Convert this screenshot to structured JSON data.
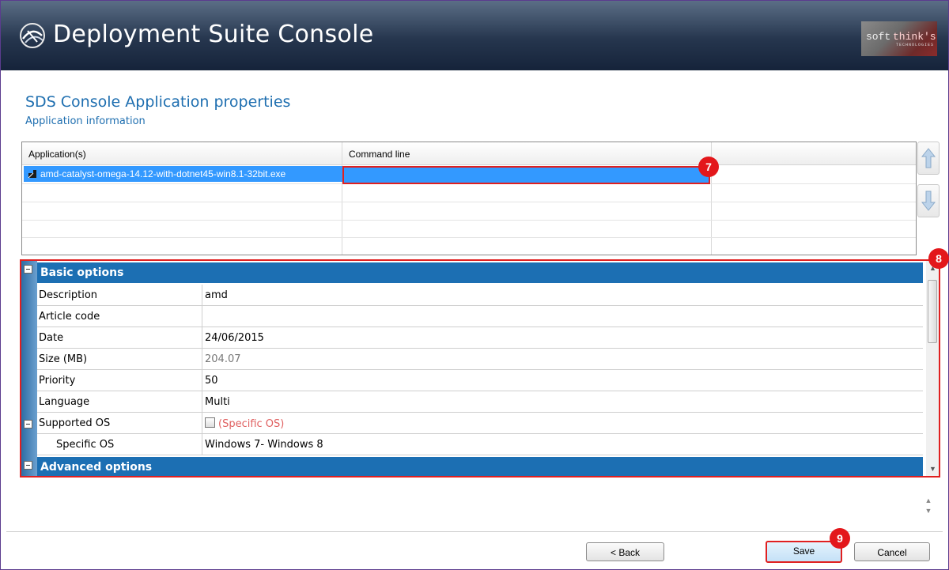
{
  "window": {
    "title": "Deployment Suite Console",
    "brand_left": "soft",
    "brand_right": "think's",
    "brand_tagline": "TECHNOLOGIES"
  },
  "page": {
    "title": "SDS Console Application properties",
    "subtitle": "Application information"
  },
  "app_grid": {
    "columns": [
      "Application(s)",
      "Command line"
    ],
    "rows": [
      {
        "application": "amd-catalyst-omega-14.12-with-dotnet45-win8.1-32bit.exe",
        "command_line": ""
      }
    ]
  },
  "properties": {
    "basic_header": "Basic options",
    "rows": [
      {
        "key": "Description",
        "value": "amd"
      },
      {
        "key": "Article code",
        "value": ""
      },
      {
        "key": "Date",
        "value": "24/06/2015"
      },
      {
        "key": "Size (MB)",
        "value": "204.07"
      },
      {
        "key": "Priority",
        "value": "50"
      },
      {
        "key": "Language",
        "value": "Multi"
      }
    ],
    "supported_os": {
      "key": "Supported OS",
      "value": "(Specific OS)",
      "checked": false
    },
    "specific_os": {
      "key": "Specific OS",
      "value": "Windows 7- Windows 8"
    },
    "advanced_header": "Advanced options"
  },
  "annotations": [
    "7",
    "8",
    "9"
  ],
  "buttons": {
    "back": "< Back",
    "save": "Save",
    "cancel": "Cancel"
  },
  "colors": {
    "accent": "#1c6fb3",
    "highlight_box": "#e02020",
    "selection": "#3399ff",
    "badge": "#e3171b"
  }
}
